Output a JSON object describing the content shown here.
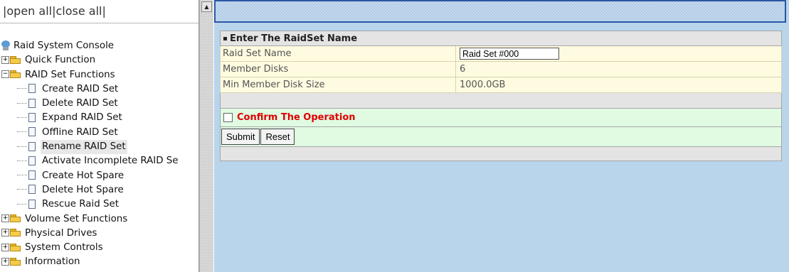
{
  "nav": {
    "open_all": "open all",
    "close_all": "close all",
    "root": "Raid System Console",
    "tree": [
      {
        "label": "Quick Function",
        "type": "folder",
        "expanded": false
      },
      {
        "label": "RAID Set Functions",
        "type": "folder",
        "expanded": true
      },
      {
        "label": "Create RAID Set",
        "type": "doc"
      },
      {
        "label": "Delete RAID Set",
        "type": "doc"
      },
      {
        "label": "Expand RAID Set",
        "type": "doc"
      },
      {
        "label": "Offline RAID Set",
        "type": "doc"
      },
      {
        "label": "Rename RAID Set",
        "type": "doc",
        "selected": true
      },
      {
        "label": "Activate Incomplete RAID Se",
        "type": "doc"
      },
      {
        "label": "Create Hot Spare",
        "type": "doc"
      },
      {
        "label": "Delete Hot Spare",
        "type": "doc"
      },
      {
        "label": "Rescue Raid Set",
        "type": "doc"
      },
      {
        "label": "Volume Set Functions",
        "type": "folder",
        "expanded": false
      },
      {
        "label": "Physical Drives",
        "type": "folder",
        "expanded": false
      },
      {
        "label": "System Controls",
        "type": "folder",
        "expanded": false
      },
      {
        "label": "Information",
        "type": "folder",
        "expanded": false
      }
    ]
  },
  "form": {
    "header": "Enter The RaidSet Name",
    "rows": [
      {
        "label": "Raid Set Name",
        "value": "Raid Set #000",
        "editable": true
      },
      {
        "label": "Member Disks",
        "value": "6"
      },
      {
        "label": "Min Member Disk Size",
        "value": "1000.0GB"
      }
    ],
    "confirm_label": "Confirm The Operation",
    "submit_label": "Submit",
    "reset_label": "Reset"
  },
  "colors": {
    "content_bg": "#b8d5ec",
    "form_row_bg": "#fffbe0",
    "confirm_bg": "#e0fbe2",
    "confirm_text": "#e00000",
    "frame_border": "#2a57a5"
  }
}
